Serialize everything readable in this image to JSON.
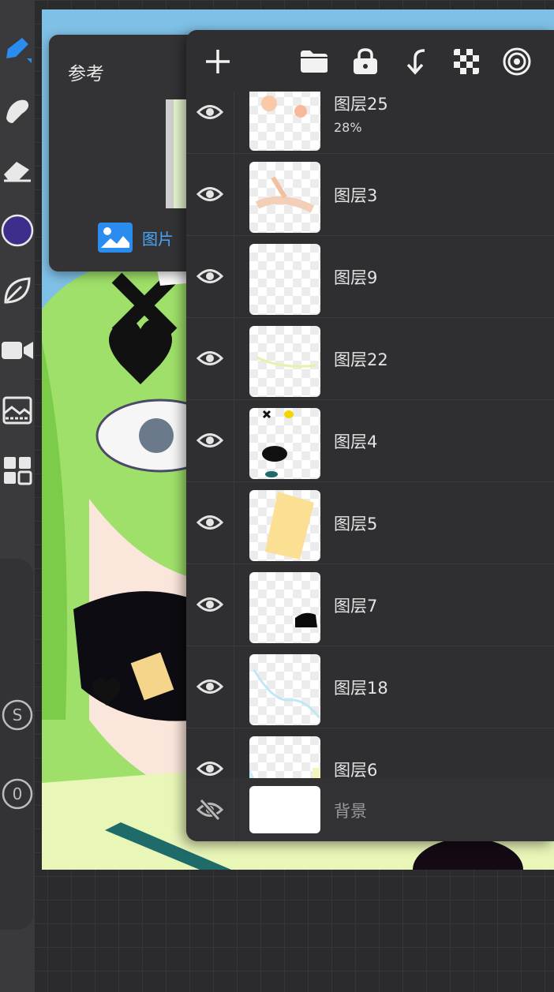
{
  "reference_panel": {
    "title": "参考",
    "tab_label": "图片"
  },
  "colors": {
    "current_color": "#3d2e8c",
    "accent": "#2b8cf0"
  },
  "toolbar": {
    "size_label": "S",
    "opacity_label": "0"
  },
  "layers_header": {
    "icons": [
      "add-icon",
      "folder-icon",
      "lock-icon",
      "merge-down-icon",
      "checker-icon",
      "target-icon"
    ]
  },
  "layers": [
    {
      "name": "图层25",
      "opacity": "28%"
    },
    {
      "name": "图层3"
    },
    {
      "name": "图层9"
    },
    {
      "name": "图层22"
    },
    {
      "name": "图层4"
    },
    {
      "name": "图层5"
    },
    {
      "name": "图层7"
    },
    {
      "name": "图层18"
    },
    {
      "name": "图层6"
    }
  ],
  "background_layer": {
    "name": "背景"
  }
}
